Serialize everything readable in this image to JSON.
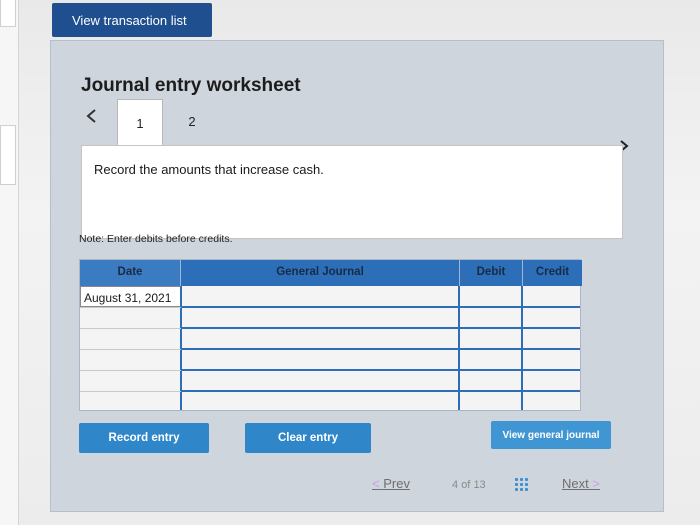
{
  "top": {
    "view_transaction_list": "View transaction list"
  },
  "worksheet": {
    "title": "Journal entry worksheet",
    "tabs": [
      {
        "label": "1",
        "active": true
      },
      {
        "label": "2",
        "active": false
      }
    ],
    "instruction": "Record the amounts that increase cash.",
    "note": "Note: Enter debits before credits."
  },
  "journal_table": {
    "headers": {
      "date": "Date",
      "general_journal": "General Journal",
      "debit": "Debit",
      "credit": "Credit"
    },
    "rows": [
      {
        "date": "August 31, 2021",
        "account": "",
        "debit": "",
        "credit": ""
      },
      {
        "date": "",
        "account": "",
        "debit": "",
        "credit": ""
      },
      {
        "date": "",
        "account": "",
        "debit": "",
        "credit": ""
      },
      {
        "date": "",
        "account": "",
        "debit": "",
        "credit": ""
      },
      {
        "date": "",
        "account": "",
        "debit": "",
        "credit": ""
      },
      {
        "date": "",
        "account": "",
        "debit": "",
        "credit": ""
      }
    ]
  },
  "buttons": {
    "record_entry": "Record entry",
    "clear_entry": "Clear entry",
    "view_general_journal": "View general journal"
  },
  "footer": {
    "prev": "Prev",
    "page_current": "4",
    "page_of": "of",
    "page_total": "13",
    "next": "Next"
  },
  "colors": {
    "primary_blue": "#2f86c9",
    "dark_blue": "#1f4f8f",
    "header_blue": "#2c6fb8"
  }
}
